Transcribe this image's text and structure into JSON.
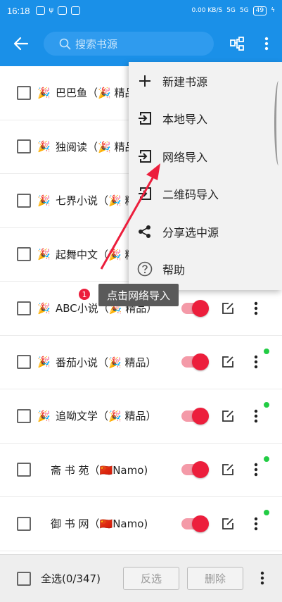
{
  "status_bar": {
    "time": "16:18",
    "net_speed": "0.00 KB/S",
    "signal1": "5G",
    "signal2": "5G",
    "battery": "49"
  },
  "toolbar": {
    "search_placeholder": "搜索书源"
  },
  "sources": [
    {
      "emoji": "🎉",
      "name": "巴巴鱼（🎉 精品）",
      "enabled": true,
      "dot": false
    },
    {
      "emoji": "🎉",
      "name": "独阅读（🎉 精品）",
      "enabled": true,
      "dot": false
    },
    {
      "emoji": "🎉",
      "name": "七界小说（🎉 精品）",
      "enabled": true,
      "dot": false
    },
    {
      "emoji": "🎉",
      "name": "起舞中文（🎉 精品）",
      "enabled": true,
      "dot": false
    },
    {
      "emoji": "🎉",
      "name": "ABC小说（🎉 精品）",
      "enabled": true,
      "dot": false
    },
    {
      "emoji": "🎉",
      "name": "番茄小说（🎉 精品）",
      "enabled": true,
      "dot": true
    },
    {
      "emoji": "🎉",
      "name": "追呦文学（🎉 精品）",
      "enabled": true,
      "dot": true
    },
    {
      "emoji": "",
      "name": "斋 书 苑（🇨🇳Namo)",
      "enabled": true,
      "dot": true
    },
    {
      "emoji": "",
      "name": "御 书 网（🇨🇳Namo)",
      "enabled": true,
      "dot": true
    }
  ],
  "menu": {
    "items": [
      {
        "icon": "plus-icon",
        "label": "新建书源"
      },
      {
        "icon": "import-icon",
        "label": "本地导入"
      },
      {
        "icon": "import-icon",
        "label": "网络导入"
      },
      {
        "icon": "import-icon",
        "label": "二维码导入"
      },
      {
        "icon": "share-icon",
        "label": "分享选中源"
      },
      {
        "icon": "help-icon",
        "label": "帮助"
      }
    ]
  },
  "annotation": {
    "step": "1",
    "text": "点击网络导入"
  },
  "bottom": {
    "select_all": "全选(0/347)",
    "invert": "反选",
    "delete": "删除"
  },
  "colors": {
    "primary": "#1a90e8",
    "accent": "#ec1e3c",
    "switch_track": "#f49aa8",
    "online_dot": "#22cc44"
  }
}
